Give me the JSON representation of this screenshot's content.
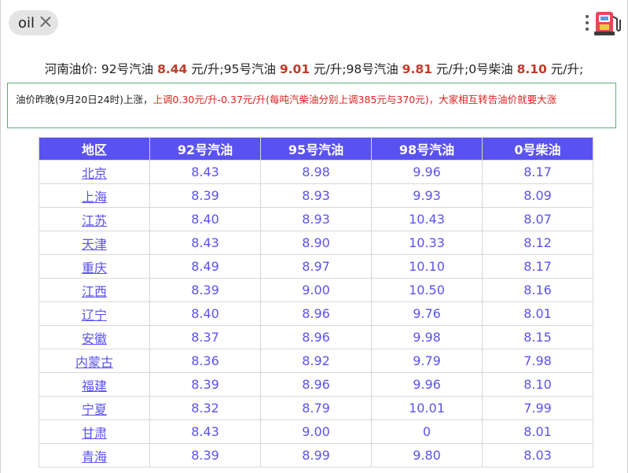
{
  "search_chip": {
    "label": "oil"
  },
  "colors": {
    "accent": "#5a52f0",
    "highlight_red": "#c0392b",
    "notice_red": "#e02020",
    "notice_border": "#5cae7a"
  },
  "icons": {
    "close": "close-icon",
    "more": "kebab-menu-icon",
    "pump": "gas-pump-icon"
  },
  "headline": {
    "prefix": "河南油价: 92号汽油 ",
    "p92": "8.44",
    "t1": " 元/升;95号汽油 ",
    "p95": "9.01",
    "t2": " 元/升;98号汽油 ",
    "p98": "9.81",
    "t3": " 元/升;0号柴油 ",
    "p0": "8.10",
    "t4": " 元/升;"
  },
  "notice": {
    "lead": "油价昨晚(9月20日24时)上涨，",
    "detail": "上调0.30元/升-0.37元/升(每吨汽柴油分别上调385元与370元)，大家相互转告油价就要大涨"
  },
  "table": {
    "headers": [
      "地区",
      "92号汽油",
      "95号汽油",
      "98号汽油",
      "0号柴油"
    ],
    "rows": [
      [
        "北京",
        "8.43",
        "8.98",
        "9.96",
        "8.17"
      ],
      [
        "上海",
        "8.39",
        "8.93",
        "9.93",
        "8.09"
      ],
      [
        "江苏",
        "8.40",
        "8.93",
        "10.43",
        "8.07"
      ],
      [
        "天津",
        "8.43",
        "8.90",
        "10.33",
        "8.12"
      ],
      [
        "重庆",
        "8.49",
        "8.97",
        "10.10",
        "8.17"
      ],
      [
        "江西",
        "8.39",
        "9.00",
        "10.50",
        "8.16"
      ],
      [
        "辽宁",
        "8.40",
        "8.96",
        "9.76",
        "8.01"
      ],
      [
        "安徽",
        "8.37",
        "8.96",
        "9.98",
        "8.15"
      ],
      [
        "内蒙古",
        "8.36",
        "8.92",
        "9.79",
        "7.98"
      ],
      [
        "福建",
        "8.39",
        "8.96",
        "9.96",
        "8.10"
      ],
      [
        "宁夏",
        "8.32",
        "8.79",
        "10.01",
        "7.99"
      ],
      [
        "甘肃",
        "8.43",
        "9.00",
        "0",
        "8.01"
      ],
      [
        "青海",
        "8.39",
        "8.99",
        "9.80",
        "8.03"
      ]
    ]
  }
}
